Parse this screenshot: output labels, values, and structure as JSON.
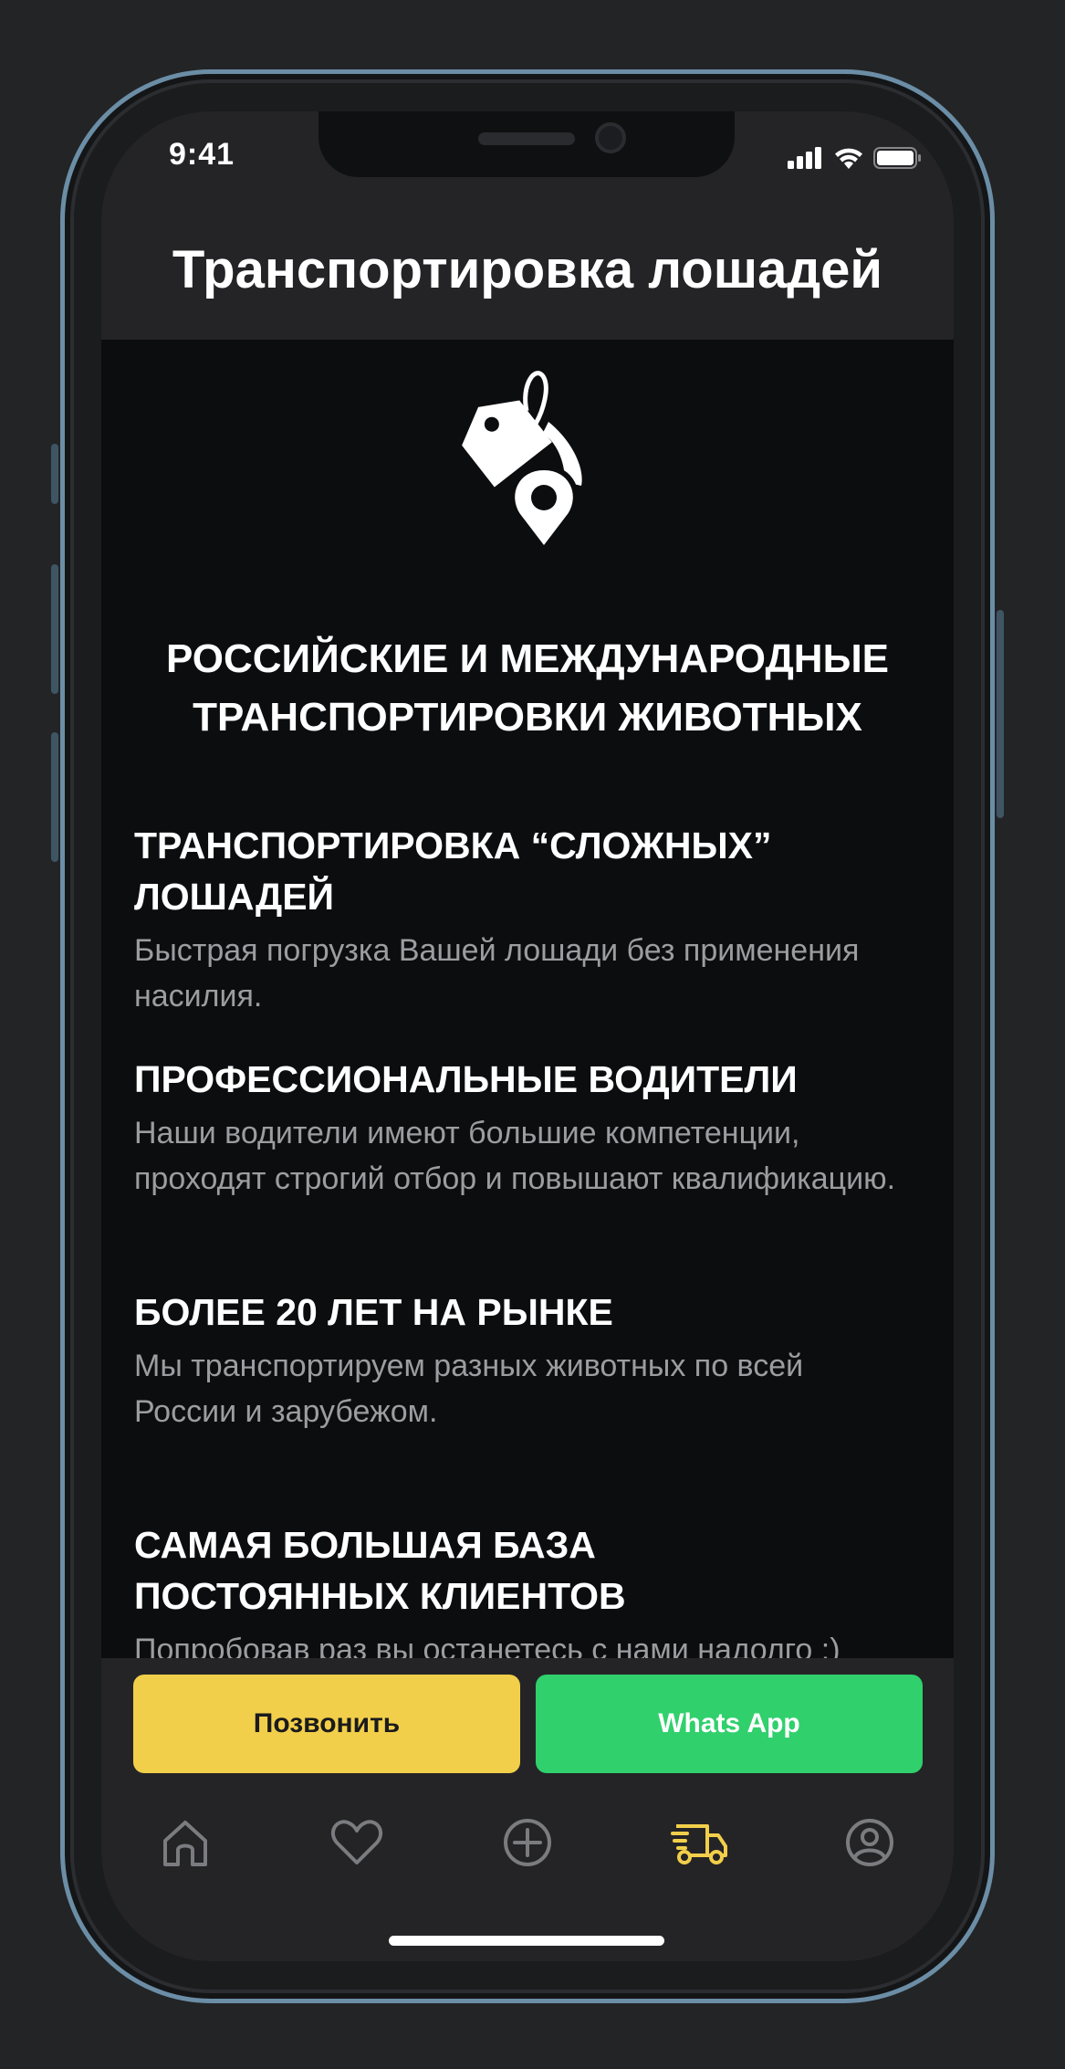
{
  "status_bar": {
    "time": "9:41"
  },
  "header": {
    "title": "Транспортировка лошадей"
  },
  "logo": {
    "icon": "tag-location-icon"
  },
  "headline": {
    "line1": "РОССИЙСКИЕ И МЕЖДУНАРОДНЫЕ",
    "line2": "ТРАНСПОРТИРОВКИ ЖИВОТНЫХ"
  },
  "features": [
    {
      "title": "ТРАНСПОРТИРОВКА “СЛОЖНЫХ” ЛОШАДЕЙ",
      "text": "Быстрая погрузка Вашей лошади без применения насилия."
    },
    {
      "title": "ПРОФЕССИОНАЛЬНЫЕ ВОДИТЕЛИ",
      "text": "Наши водители имеют большие компетенции, проходят строгий отбор и повышают квалификацию."
    },
    {
      "title": "БОЛЕЕ 20 ЛЕТ НА РЫНКЕ",
      "text": "Мы транспортируем разных животных по всей России и зарубежом."
    },
    {
      "title": "САМАЯ БОЛЬШАЯ БАЗА  ПОСТОЯННЫХ КЛИЕНТОВ",
      "text": "Попробовав раз вы останетесь с нами надолго :)"
    }
  ],
  "actions": {
    "call_label": "Позвонить",
    "whatsapp_label": "Whats App"
  },
  "tab_bar": {
    "items": [
      {
        "icon": "home-icon",
        "active": false
      },
      {
        "icon": "heart-icon",
        "active": false
      },
      {
        "icon": "plus-circle-icon",
        "active": false
      },
      {
        "icon": "truck-icon",
        "active": true
      },
      {
        "icon": "profile-icon",
        "active": false
      }
    ]
  },
  "colors": {
    "accent_yellow": "#f2cf4a",
    "whatsapp_green": "#30d06c",
    "background": "#0c0d0f",
    "bar_background": "#242427",
    "inactive_icon": "#7b7c80"
  }
}
